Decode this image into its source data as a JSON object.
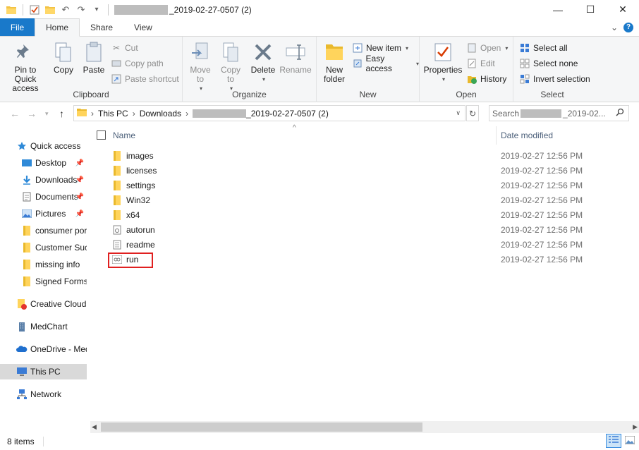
{
  "window": {
    "title_suffix": "_2019-02-27-0507 (2)",
    "minimize": "—",
    "maximize": "☐",
    "close": "✕"
  },
  "tabs": [
    {
      "label": "File"
    },
    {
      "label": "Home"
    },
    {
      "label": "Share"
    },
    {
      "label": "View"
    }
  ],
  "ribbon": {
    "clipboard": {
      "label": "Clipboard",
      "pin_quick_access": "Pin to Quick access",
      "copy": "Copy",
      "paste": "Paste",
      "cut": "Cut",
      "copy_path": "Copy path",
      "paste_shortcut": "Paste shortcut"
    },
    "organize": {
      "label": "Organize",
      "move_to": "Move to",
      "copy_to": "Copy to",
      "delete": "Delete",
      "rename": "Rename"
    },
    "new": {
      "label": "New",
      "new_folder": "New folder",
      "new_item": "New item",
      "easy_access": "Easy access"
    },
    "open": {
      "label": "Open",
      "properties": "Properties",
      "open": "Open",
      "edit": "Edit",
      "history": "History"
    },
    "select": {
      "label": "Select",
      "select_all": "Select all",
      "select_none": "Select none",
      "invert_selection": "Invert selection"
    }
  },
  "address": {
    "this_pc": "This PC",
    "downloads": "Downloads",
    "folder_suffix": "_2019-02-27-0507 (2)",
    "search_prefix": "Search",
    "search_suffix": "_2019-02..."
  },
  "nav": [
    {
      "label": "Quick access",
      "icon": "star-icon"
    },
    {
      "label": "Desktop",
      "icon": "desktop-icon",
      "pinned": true
    },
    {
      "label": "Downloads",
      "icon": "download-icon",
      "pinned": true
    },
    {
      "label": "Documents",
      "icon": "documents-icon",
      "pinned": true
    },
    {
      "label": "Pictures",
      "icon": "pictures-icon",
      "pinned": true
    },
    {
      "label": "consumer portal",
      "icon": "folder-icon"
    },
    {
      "label": "Customer Success",
      "icon": "folder-icon"
    },
    {
      "label": "missing info",
      "icon": "folder-icon"
    },
    {
      "label": "Signed Forms",
      "icon": "folder-icon"
    },
    {
      "label": "Creative Cloud Files",
      "icon": "creative-cloud-icon"
    },
    {
      "label": "MedChart",
      "icon": "building-icon"
    },
    {
      "label": "OneDrive - MedChart",
      "icon": "onedrive-icon"
    },
    {
      "label": "This PC",
      "icon": "computer-icon"
    },
    {
      "label": "Network",
      "icon": "network-icon"
    }
  ],
  "columns": {
    "name": "Name",
    "date_modified": "Date modified"
  },
  "files": [
    {
      "name": "images",
      "type": "folder",
      "date": "2019-02-27 12:56 PM"
    },
    {
      "name": "licenses",
      "type": "folder",
      "date": "2019-02-27 12:56 PM"
    },
    {
      "name": "settings",
      "type": "folder",
      "date": "2019-02-27 12:56 PM"
    },
    {
      "name": "Win32",
      "type": "folder",
      "date": "2019-02-27 12:56 PM"
    },
    {
      "name": "x64",
      "type": "folder",
      "date": "2019-02-27 12:56 PM"
    },
    {
      "name": "autorun",
      "type": "config",
      "date": "2019-02-27 12:56 PM"
    },
    {
      "name": "readme",
      "type": "text",
      "date": "2019-02-27 12:56 PM"
    },
    {
      "name": "run",
      "type": "script",
      "date": "2019-02-27 12:56 PM"
    }
  ],
  "status": {
    "count": "8 items"
  }
}
